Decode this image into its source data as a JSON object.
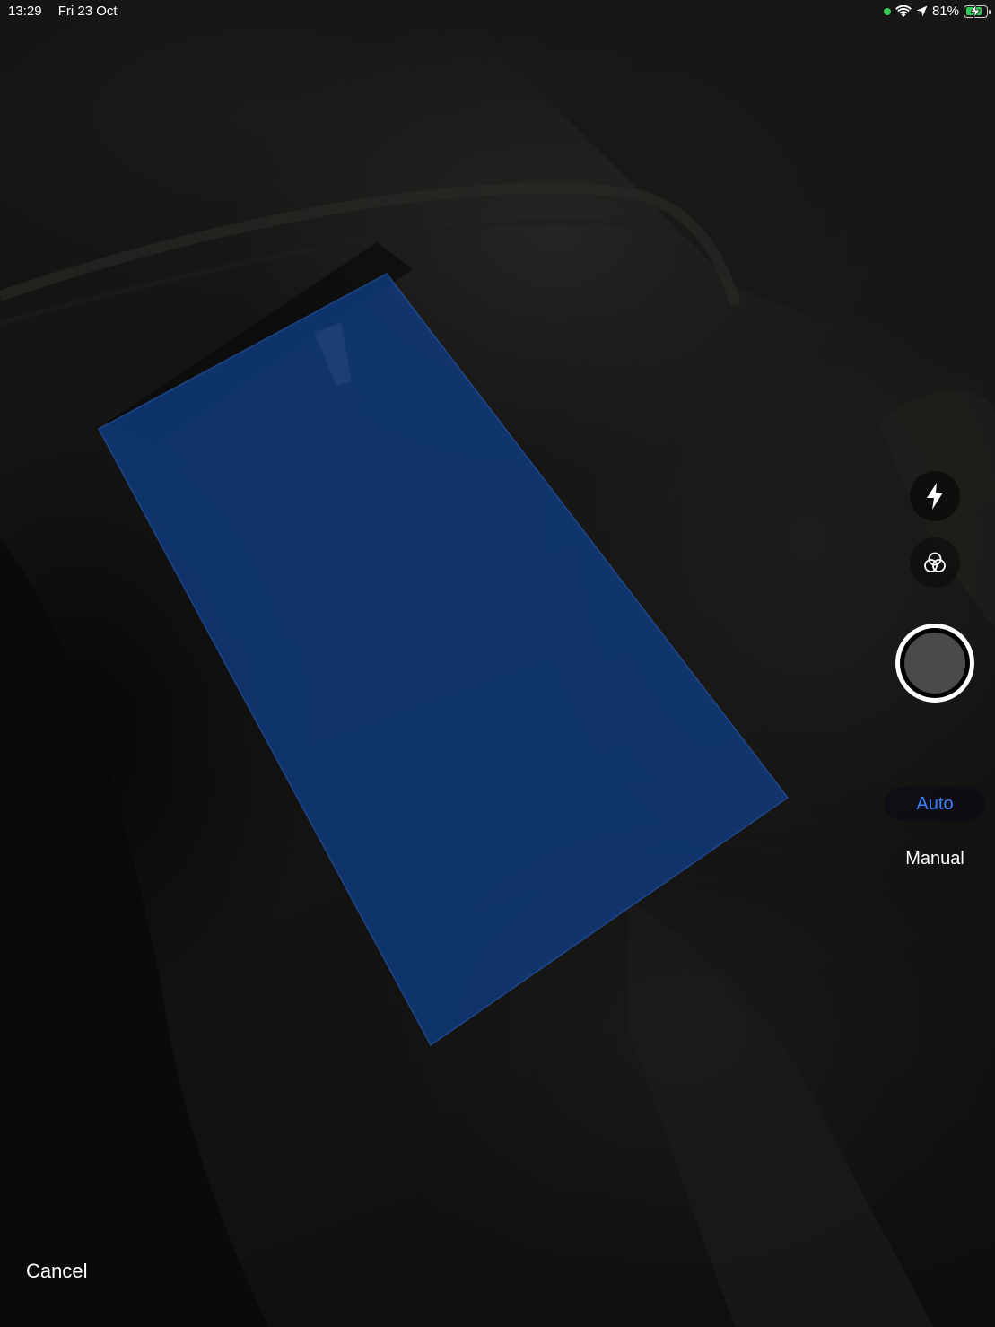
{
  "status_bar": {
    "time": "13:29",
    "date": "Fri 23 Oct",
    "battery_percent": "81%",
    "battery_level": 0.81,
    "icons": [
      "camera-in-use-dot",
      "wifi-icon",
      "location-arrow-icon",
      "battery-charging-icon"
    ]
  },
  "scanner": {
    "detected_document_color": "#0f3a7f",
    "controls": {
      "flash_icon": "flash-icon",
      "filter_icon": "filters-icon",
      "shutter_icon": "shutter-button"
    },
    "modes": {
      "auto_label": "Auto",
      "manual_label": "Manual",
      "selected": "Auto"
    },
    "cancel_label": "Cancel"
  },
  "colors": {
    "accent_blue": "#3f7bff",
    "status_green": "#34c759"
  }
}
